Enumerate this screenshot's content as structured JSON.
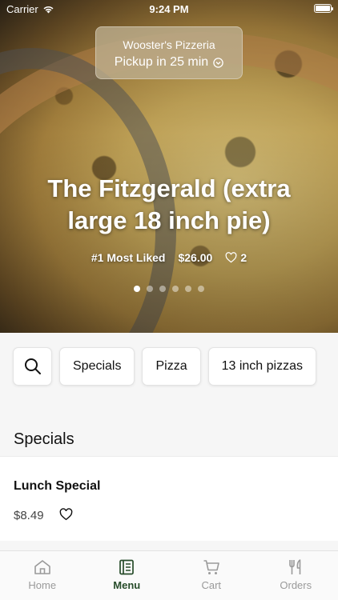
{
  "status_bar": {
    "carrier": "Carrier",
    "time": "9:24 PM"
  },
  "store": {
    "name": "Wooster's Pizzeria",
    "pickup": "Pickup in 25 min"
  },
  "featured": {
    "title": "The Fitzgerald (extra large 18 inch pie)",
    "badge": "#1 Most Liked",
    "price": "$26.00",
    "likes": "2",
    "carousel": {
      "count": 6,
      "active": 1
    }
  },
  "categories": [
    "Specials",
    "Pizza",
    "13 inch pizzas"
  ],
  "section": {
    "title": "Specials"
  },
  "items": [
    {
      "name": "Lunch Special",
      "price": "$8.49"
    }
  ],
  "tabs": [
    {
      "label": "Home",
      "icon": "home-icon"
    },
    {
      "label": "Menu",
      "icon": "menu-icon"
    },
    {
      "label": "Cart",
      "icon": "cart-icon"
    },
    {
      "label": "Orders",
      "icon": "fork-knife-icon"
    }
  ],
  "colors": {
    "active_tab": "#274c2a",
    "inactive_tab": "#9a9a9a"
  }
}
